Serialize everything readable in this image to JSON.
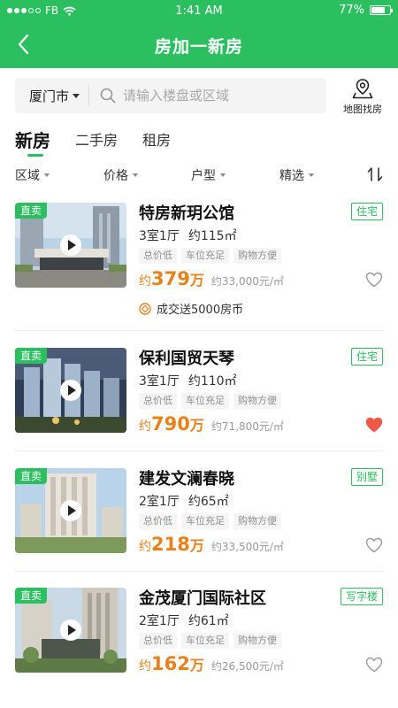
{
  "status_bar": {
    "carrier": "FB",
    "time": "1:41 AM",
    "battery": "77%",
    "battery_level": 0.77
  },
  "header": {
    "title": "房加一新房"
  },
  "search": {
    "city": "厦门市",
    "placeholder": "请输入楼盘或区域",
    "map_label": "地图找房"
  },
  "tabs": [
    {
      "label": "新房"
    },
    {
      "label": "二手房"
    },
    {
      "label": "租房"
    }
  ],
  "filters": [
    {
      "label": "区域"
    },
    {
      "label": "价格"
    },
    {
      "label": "户型"
    },
    {
      "label": "精选"
    }
  ],
  "colors": {
    "brand": "#2bbf60",
    "price": "#e8801b",
    "favorite": "#f0584a"
  },
  "listings": [
    {
      "badge": "直卖",
      "name": "特房新玥公馆",
      "type_tag": "住宅",
      "rooms": "3室1厅",
      "area": "约115㎡",
      "tags": [
        "总价低",
        "车位充足",
        "购物方便"
      ],
      "price_prefix": "约",
      "price": "379",
      "price_unit": "万",
      "unit_price": "约33,000元/㎡",
      "promo": "成交送5000房币",
      "favorite": false
    },
    {
      "badge": "直卖",
      "name": "保利国贸天琴",
      "type_tag": "住宅",
      "rooms": "3室1厅",
      "area": "约110㎡",
      "tags": [
        "总价低",
        "车位充足",
        "购物方便"
      ],
      "price_prefix": "约",
      "price": "790",
      "price_unit": "万",
      "unit_price": "约71,800元/㎡",
      "favorite": true
    },
    {
      "badge": "直卖",
      "name": "建发文澜春晓",
      "type_tag": "别墅",
      "rooms": "2室1厅",
      "area": "约65㎡",
      "tags": [
        "总价低",
        "车位充足",
        "购物方便"
      ],
      "price_prefix": "约",
      "price": "218",
      "price_unit": "万",
      "unit_price": "约33,500元/㎡",
      "favorite": false
    },
    {
      "badge": "直卖",
      "name": "金茂厦门国际社区",
      "type_tag": "写字楼",
      "rooms": "2室1厅",
      "area": "约61㎡",
      "tags": [
        "总价低",
        "车位充足",
        "购物方便"
      ],
      "price_prefix": "约",
      "price": "162",
      "price_unit": "万",
      "unit_price": "约26,500元/㎡",
      "favorite": false
    }
  ]
}
